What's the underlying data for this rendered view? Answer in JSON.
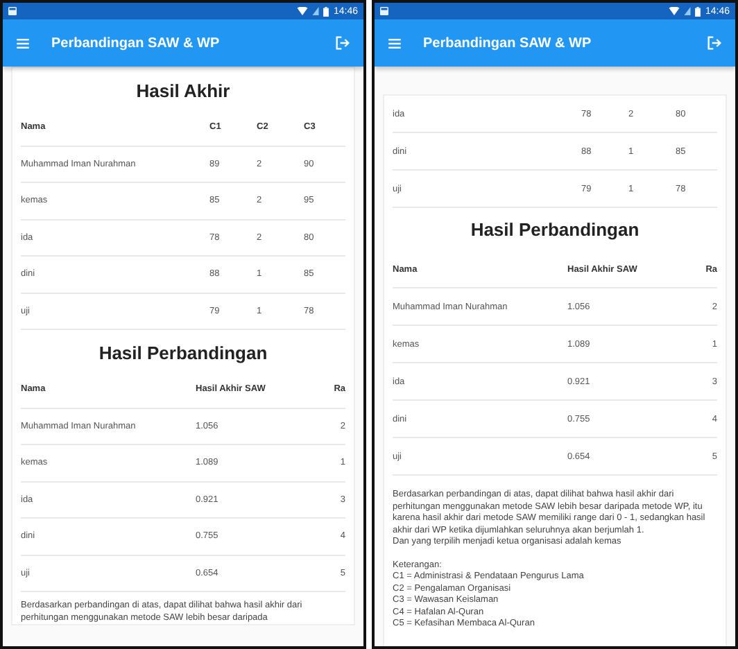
{
  "screens": [
    {
      "status_bar": {
        "time": "14:46"
      },
      "app_bar": {
        "title": "Perbandingan SAW & WP"
      },
      "blocks": [
        {
          "kind": "heading",
          "text": "Hasil Akhir"
        },
        {
          "kind": "table",
          "columns": [
            "Nama",
            "C1",
            "C2",
            "C3"
          ],
          "rows": [
            [
              "Muhammad Iman Nurahman",
              "89",
              "2",
              "90"
            ],
            [
              "kemas",
              "85",
              "2",
              "95"
            ],
            [
              "ida",
              "78",
              "2",
              "80"
            ],
            [
              "dini",
              "88",
              "1",
              "85"
            ],
            [
              "uji",
              "79",
              "1",
              "78"
            ]
          ]
        },
        {
          "kind": "heading",
          "text": "Hasil Perbandingan"
        },
        {
          "kind": "table",
          "columns": [
            "Nama",
            "Hasil Akhir SAW",
            "Ra"
          ],
          "rows": [
            [
              "Muhammad Iman Nurahman",
              "1.056",
              "2"
            ],
            [
              "kemas",
              "1.089",
              "1"
            ],
            [
              "ida",
              "0.921",
              "3"
            ],
            [
              "dini",
              "0.755",
              "4"
            ],
            [
              "uji",
              "0.654",
              "5"
            ]
          ]
        },
        {
          "kind": "paragraph",
          "texts": [
            "Berdasarkan perbandingan di atas, dapat dilihat bahwa hasil akhir dari perhitungan menggunakan metode SAW lebih besar daripada"
          ]
        }
      ]
    },
    {
      "status_bar": {
        "time": "14:46"
      },
      "app_bar": {
        "title": "Perbandingan SAW & WP"
      },
      "blocks": [
        {
          "kind": "table",
          "rows": [
            [
              "ida",
              "78",
              "2",
              "80"
            ],
            [
              "dini",
              "88",
              "1",
              "85"
            ],
            [
              "uji",
              "79",
              "1",
              "78"
            ]
          ]
        },
        {
          "kind": "heading",
          "text": "Hasil Perbandingan"
        },
        {
          "kind": "table",
          "columns": [
            "Nama",
            "Hasil Akhir SAW",
            "Ra"
          ],
          "rows": [
            [
              "Muhammad Iman Nurahman",
              "1.056",
              "2"
            ],
            [
              "kemas",
              "1.089",
              "1"
            ],
            [
              "ida",
              "0.921",
              "3"
            ],
            [
              "dini",
              "0.755",
              "4"
            ],
            [
              "uji",
              "0.654",
              "5"
            ]
          ]
        },
        {
          "kind": "paragraph",
          "texts": [
            "Berdasarkan perbandingan di atas, dapat dilihat bahwa hasil akhir dari perhitungan menggunakan metode SAW lebih besar daripada metode WP, itu karena hasil akhir dari metode SAW memiliki range dari 0 - 1, sedangkan hasil akhir dari WP ketika dijumlahkan seluruhnya akan berjumlah 1.",
            "Dan yang terpilih menjadi ketua organisasi adalah kemas"
          ]
        },
        {
          "kind": "legend",
          "title": "Keterangan:",
          "items": [
            "C1 = Administrasi & Pendataan Pengurus Lama",
            "C2 = Pengalaman Organisasi",
            "C3 = Wawasan Keislaman",
            "C4 = Hafalan Al-Quran",
            "C5 = Kefasihan Membaca Al-Quran"
          ]
        }
      ]
    }
  ]
}
